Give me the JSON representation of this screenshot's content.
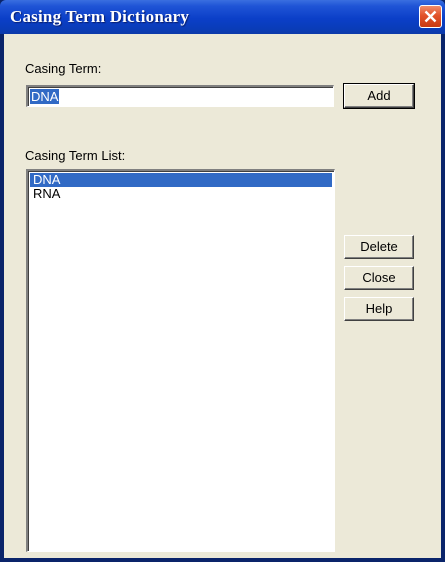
{
  "window": {
    "title": "Casing Term Dictionary"
  },
  "casing_term": {
    "label": "Casing Term:",
    "value": "DNA"
  },
  "list": {
    "label": "Casing Term List:",
    "items": [
      "DNA",
      "RNA"
    ],
    "selected_index": 0
  },
  "buttons": {
    "add": "Add",
    "delete": "Delete",
    "close": "Close",
    "help": "Help"
  },
  "icons": {
    "close": "close-icon"
  }
}
